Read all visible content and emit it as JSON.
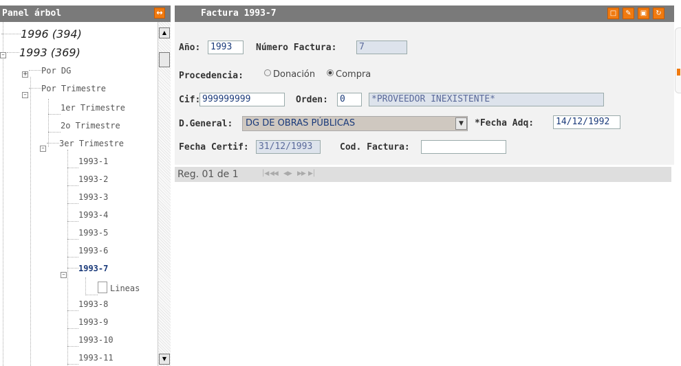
{
  "left_panel": {
    "title": "Panel árbol",
    "tree": [
      {
        "label": "1996 (394)"
      },
      {
        "label": "1993 (369)"
      },
      {
        "label": "Por DG"
      },
      {
        "label": "Por Trimestre"
      },
      {
        "label": "1er Trimestre"
      },
      {
        "label": "2o Trimestre"
      },
      {
        "label": "3er Trimestre"
      },
      {
        "label": "1993-1"
      },
      {
        "label": "1993-2"
      },
      {
        "label": "1993-3"
      },
      {
        "label": "1993-4"
      },
      {
        "label": "1993-5"
      },
      {
        "label": "1993-6"
      },
      {
        "label": "1993-7"
      },
      {
        "label": "Lineas"
      },
      {
        "label": "1993-8"
      },
      {
        "label": "1993-9"
      },
      {
        "label": "1993-10"
      },
      {
        "label": "1993-11"
      }
    ]
  },
  "form": {
    "title": "Factura 1993-7",
    "anio_label": "Año:",
    "anio_value": "1993",
    "numero_label": "Número Factura:",
    "numero_value": "7",
    "procedencia_label": "Procedencia:",
    "opt_donacion": "Donación",
    "opt_compra": "Compra",
    "selected_option": "Compra",
    "cif_label": "Cif:",
    "cif_value": "999999999",
    "orden_label": "Orden:",
    "orden_value": "0",
    "proveedor_value": "*PROVEEDOR INEXISTENTE*",
    "dgeneral_label": "D.General:",
    "dgeneral_value": "DG DE OBRAS PÚBLICAS",
    "fecha_adq_label": "*Fecha Adq:",
    "fecha_adq_value": "14/12/1992",
    "fecha_certif_label": "Fecha Certif:",
    "fecha_certif_value": "31/12/1993",
    "cod_factura_label": "Cod. Factura:",
    "cod_factura_value": ""
  },
  "navbar": {
    "record_text": "Reg. 01 de 1"
  },
  "colors": {
    "header": "#7a7a7a",
    "accent": "#f07a10",
    "form_bg": "#f2f2f2"
  }
}
